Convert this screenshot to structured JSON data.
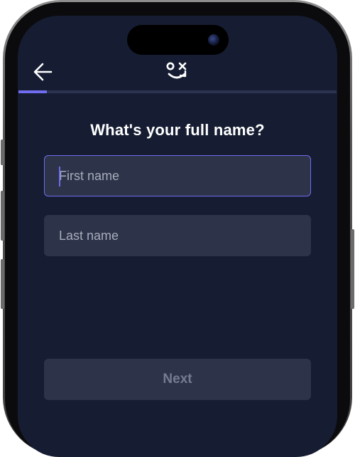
{
  "header": {
    "back_icon": "arrow-left-icon",
    "logo_icon": "smiley-logo-icon"
  },
  "progress": {
    "fraction": 0.09
  },
  "form": {
    "title": "What's your full name?",
    "first_name_placeholder": "First name",
    "first_name_value": "",
    "last_name_placeholder": "Last name",
    "last_name_value": ""
  },
  "footer": {
    "next_label": "Next"
  },
  "colors": {
    "background": "#161d32",
    "accent": "#6d6cf0",
    "field": "#2d3348",
    "text": "#ffffff",
    "placeholder": "#a7acbd",
    "disabled_text": "#767c90"
  }
}
